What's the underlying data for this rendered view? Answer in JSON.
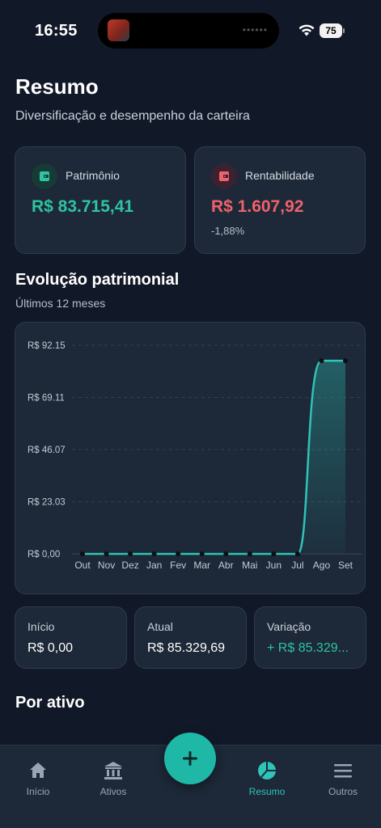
{
  "status_bar": {
    "time": "16:55",
    "battery": "75"
  },
  "header": {
    "title": "Resumo",
    "subtitle": "Diversificação e desempenho da carteira"
  },
  "cards": {
    "patrimonio": {
      "label": "Patrimônio",
      "value": "R$ 83.715,41",
      "color": "#2ec4a0"
    },
    "rentabilidade": {
      "label": "Rentabilidade",
      "value": "R$ 1.607,92",
      "sub": "-1,88%",
      "color": "#f0626a"
    }
  },
  "evolucao": {
    "title": "Evolução patrimonial",
    "subtitle": "Últimos 12 meses"
  },
  "chart_data": {
    "type": "area",
    "title": "",
    "xlabel": "",
    "ylabel": "",
    "categories": [
      "Out",
      "Nov",
      "Dez",
      "Jan",
      "Fev",
      "Mar",
      "Abr",
      "Mai",
      "Jun",
      "Jul",
      "Ago",
      "Set"
    ],
    "y_ticks": [
      "R$ 0,00",
      "R$ 23.03",
      "R$ 46.07",
      "R$ 69.11",
      "R$ 92.15"
    ],
    "ylim": [
      0,
      92150
    ],
    "series": [
      {
        "values": [
          0,
          0,
          0,
          0,
          0,
          0,
          0,
          0,
          0,
          0,
          85330,
          85330
        ]
      }
    ],
    "grid": true,
    "line_color": "#2ec4b6"
  },
  "stats": {
    "inicio": {
      "label": "Início",
      "value": "R$ 0,00"
    },
    "atual": {
      "label": "Atual",
      "value": "R$ 85.329,69"
    },
    "variacao": {
      "label": "Variação",
      "value": "+ R$ 85.329...",
      "color": "#2ec4a0"
    }
  },
  "por_ativo": {
    "title": "Por ativo"
  },
  "tabs": [
    {
      "label": "Início",
      "icon": "home-icon"
    },
    {
      "label": "Ativos",
      "icon": "bank-icon"
    },
    {
      "label": "Resumo",
      "icon": "pie-chart-icon",
      "active": true
    },
    {
      "label": "Outros",
      "icon": "menu-icon"
    }
  ],
  "fab": {
    "symbol": "+"
  }
}
